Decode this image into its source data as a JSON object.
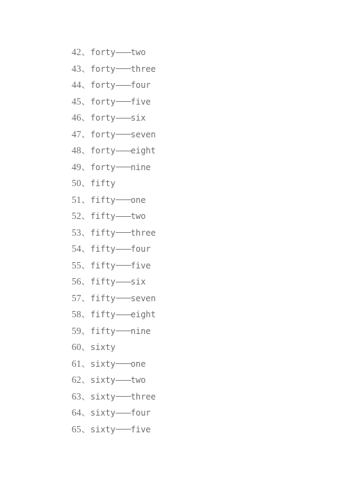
{
  "document": {
    "background_color": "#ffffff",
    "text_color": "#6e6e6e",
    "separator": "——",
    "enumeration_mark": "、",
    "lines": [
      {
        "number": "42",
        "mark": "、",
        "head": "forty",
        "sep": "——",
        "tail": "two",
        "text": "42、forty——two"
      },
      {
        "number": "43",
        "mark": "、",
        "head": "forty",
        "sep": "——",
        "tail": "three",
        "text": "43、forty——three"
      },
      {
        "number": "44",
        "mark": "、",
        "head": "forty",
        "sep": "——",
        "tail": "four",
        "text": "44、forty——four"
      },
      {
        "number": "45",
        "mark": "、",
        "head": "forty",
        "sep": "——",
        "tail": "five",
        "text": "45、forty——five"
      },
      {
        "number": "46",
        "mark": "、",
        "head": "forty",
        "sep": "——",
        "tail": "six",
        "text": "46、forty——six"
      },
      {
        "number": "47",
        "mark": "、",
        "head": "forty",
        "sep": "——",
        "tail": "seven",
        "text": "47、forty——seven"
      },
      {
        "number": "48",
        "mark": "、",
        "head": "forty",
        "sep": "——",
        "tail": "eight",
        "text": "48、forty——eight"
      },
      {
        "number": "49",
        "mark": "、",
        "head": "forty",
        "sep": "——",
        "tail": "nine",
        "text": "49、forty——nine"
      },
      {
        "number": "50",
        "mark": "、",
        "head": "fifty",
        "sep": "",
        "tail": "",
        "text": "50、fifty"
      },
      {
        "number": "51",
        "mark": "、",
        "head": "fifty",
        "sep": "——",
        "tail": "one",
        "text": "51、fifty——one"
      },
      {
        "number": "52",
        "mark": "、",
        "head": "fifty",
        "sep": "——",
        "tail": "two",
        "text": "52、fifty——two"
      },
      {
        "number": "53",
        "mark": "、",
        "head": "fifty",
        "sep": "——",
        "tail": "three",
        "text": "53、fifty——three"
      },
      {
        "number": "54",
        "mark": "、",
        "head": "fifty",
        "sep": "——",
        "tail": "four",
        "text": "54、fifty——four"
      },
      {
        "number": "55",
        "mark": "、",
        "head": "fifty",
        "sep": "——",
        "tail": "five",
        "text": "55、fifty——five"
      },
      {
        "number": "56",
        "mark": "、",
        "head": "fifty",
        "sep": "——",
        "tail": "six",
        "text": "56、fifty——six"
      },
      {
        "number": "57",
        "mark": "、",
        "head": "fifty",
        "sep": "——",
        "tail": "seven",
        "text": "57、fifty——seven"
      },
      {
        "number": "58",
        "mark": "、",
        "head": "fifty",
        "sep": "——",
        "tail": "eight",
        "text": "58、fifty——eight"
      },
      {
        "number": "59",
        "mark": "、",
        "head": "fifty",
        "sep": "——",
        "tail": "nine",
        "text": "59、fifty——nine"
      },
      {
        "number": "60",
        "mark": "、",
        "head": "sixty",
        "sep": "",
        "tail": "",
        "text": "60、sixty"
      },
      {
        "number": "61",
        "mark": "、",
        "head": "sixty",
        "sep": "——",
        "tail": "one",
        "text": "61、sixty——one"
      },
      {
        "number": "62",
        "mark": "、",
        "head": "sixty",
        "sep": "——",
        "tail": "two",
        "text": "62、sixty——two"
      },
      {
        "number": "63",
        "mark": "、",
        "head": "sixty",
        "sep": "——",
        "tail": "three",
        "text": "63、sixty——three"
      },
      {
        "number": "64",
        "mark": "、",
        "head": "sixty",
        "sep": "——",
        "tail": "four",
        "text": "64、sixty——four"
      },
      {
        "number": "65",
        "mark": "、",
        "head": "sixty",
        "sep": "——",
        "tail": "five",
        "text": "65、sixty——five"
      }
    ]
  }
}
